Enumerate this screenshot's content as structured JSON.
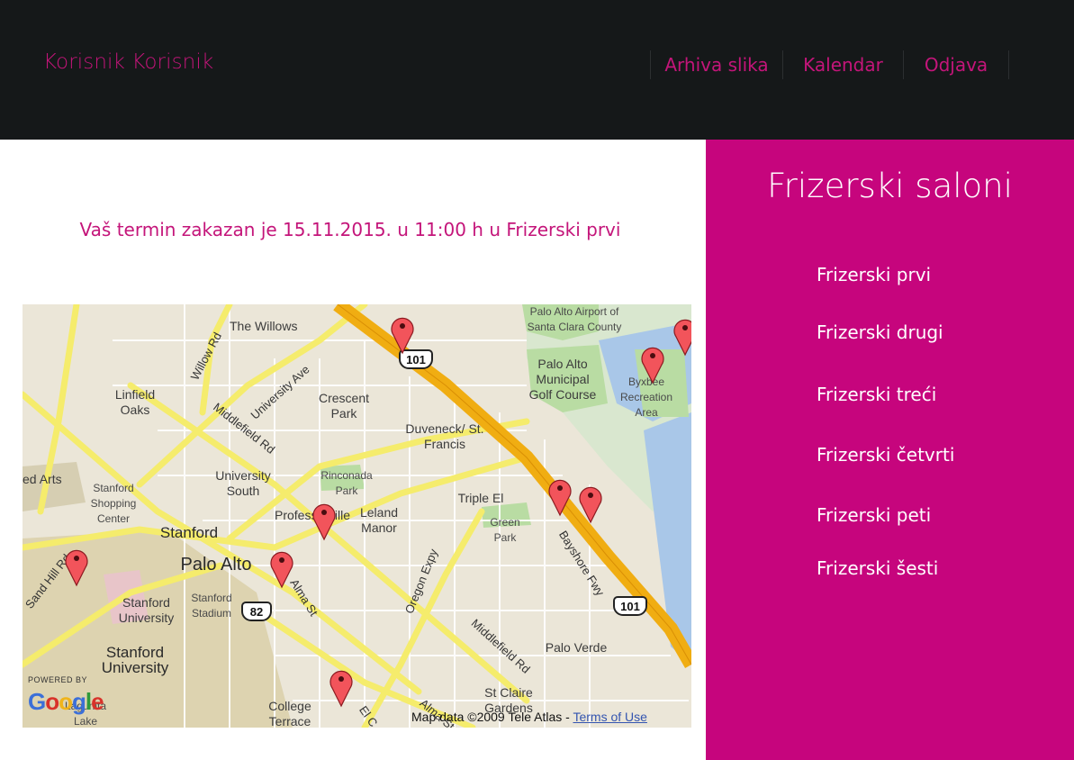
{
  "header": {
    "user_name": "Korisnik Korisnik",
    "nav": [
      {
        "label": "Arhiva slika"
      },
      {
        "label": "Kalendar"
      },
      {
        "label": "Odjava"
      }
    ]
  },
  "main": {
    "message": "Vaš termin zakazan je 15.11.2015. u 11:00 h u Frizerski prvi"
  },
  "map": {
    "places": [
      "The Willows",
      "Palo Alto Airport of Santa Clara County",
      "Palo Alto Municipal Golf Course",
      "Byxbee Recreation Area",
      "Linfield Oaks",
      "Crescent Park",
      "Duveneck/ St. Francis",
      "University South",
      "Rinconada Park",
      "Triple El",
      "Green Park",
      "Leland Manor",
      "Professorville",
      "Stanford Shopping Center",
      "Stanford",
      "Palo Alto",
      "Stanford University",
      "Stanford Stadium",
      "Stanford University",
      "Palo Verde",
      "St Claire Gardens",
      "College Terrace",
      "Lagunita Lake",
      "ed Arts"
    ],
    "roads": [
      "Willow Rd",
      "University Ave",
      "Middlefield Rd",
      "Bayshore Fwy",
      "Oregon Expy",
      "Middlefield Rd",
      "Alma St",
      "Sand Hill Rd",
      "El C",
      "Alma St"
    ],
    "shields": [
      "101",
      "101",
      "82"
    ],
    "powered_by": "POWERED BY",
    "google_logo": "Google",
    "attribution": "Map data ©2009 Tele Atlas - ",
    "terms": "Terms of Use",
    "colors": {
      "marker": "#f2545b",
      "highway": "#f3b51b",
      "road": "#fff27a",
      "park": "#b7dca0",
      "water": "#9fc0e6"
    }
  },
  "sidebar": {
    "title": "Frizerski saloni",
    "salons": [
      {
        "label": "Frizerski prvi"
      },
      {
        "label": "Frizerski drugi"
      },
      {
        "label": "Frizerski treći"
      },
      {
        "label": "Frizerski četvrti"
      },
      {
        "label": "Frizerski peti"
      },
      {
        "label": "Frizerski šesti"
      }
    ]
  },
  "colors": {
    "accent": "#c6057d",
    "header_bg": "#151819"
  }
}
